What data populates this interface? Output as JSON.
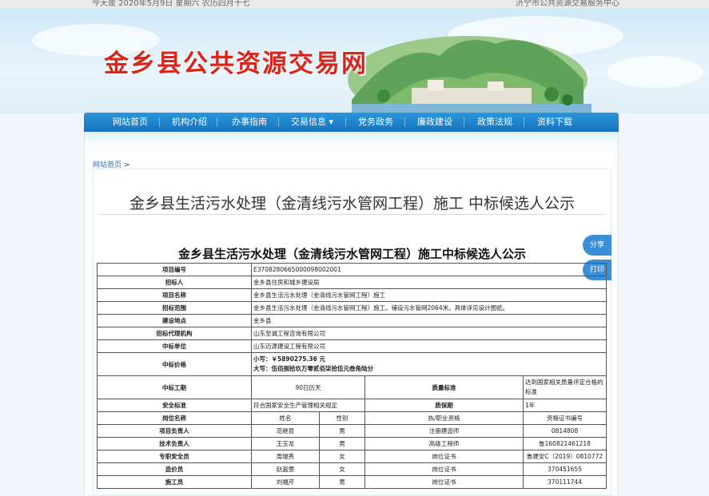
{
  "topbar": {
    "date_text": "今天是 2020年5月9日 星期六 农历四月十七",
    "right_text": "济宁市公共资源交易服务中心"
  },
  "site": {
    "title": "金乡县公共资源交易网"
  },
  "nav": {
    "items": [
      {
        "label": "网站首页"
      },
      {
        "label": "机构介绍"
      },
      {
        "label": "办事指南"
      },
      {
        "label": "交易信息 ▾"
      },
      {
        "label": "党务政务"
      },
      {
        "label": "廉政建设"
      },
      {
        "label": "政策法规"
      },
      {
        "label": "资料下载"
      }
    ]
  },
  "breadcrumb": {
    "home": "网站首页",
    "separator": ">"
  },
  "page_title": "金乡县生活污水处理（金清线污水管网工程）施工 中标候选人公示",
  "doc_title": "金乡县生活污水处理（金清线污水管网工程）施工中标候选人公示",
  "side": {
    "share": "分享",
    "print": "打印"
  },
  "table": {
    "project_no": {
      "label": "项目编号",
      "value": "E3708280665000098002001"
    },
    "tenderer": {
      "label": "招标人",
      "value": "金乡县住房和城乡建设局"
    },
    "project_name": {
      "label": "项目名称",
      "value": "金乡县生活污水处理（金清线污水管网工程）施工"
    },
    "scope": {
      "label": "招标范围",
      "value": "金乡县生活污水处理（金清线污水管网工程）施工。铺设污水管网2064米。具体详见设计图纸。"
    },
    "location": {
      "label": "建设地点",
      "value": "金乡县"
    },
    "agency": {
      "label": "招标代理机构",
      "value": "山东至诚工程咨询有限公司"
    },
    "winner": {
      "label": "中标单位",
      "value": "山东迈源建设工程有限公司"
    },
    "price": {
      "label": "中标价格",
      "small": "小写：￥5890275.36  元",
      "big": "大写：伍佰捌拾玖万零贰佰柒拾伍元叁角陆分"
    },
    "period": {
      "label": "中标工期",
      "value": "90日历天",
      "quality_label": "质量标准",
      "quality_value": "达到国家相关质量评定合格的标准"
    },
    "safety": {
      "label": "安全标准",
      "value": "符合国家安全生产管理相关规定",
      "warranty_label": "质保期",
      "warranty_value": "1年"
    },
    "staff_header": {
      "role": "岗位名称",
      "name": "姓名",
      "gender": "性别",
      "qual": "执/职业资格",
      "cert": "资格证书编号"
    },
    "staff": [
      {
        "role": "项目负责人",
        "name": "范继昆",
        "gender": "男",
        "qual": "注册建造师",
        "cert": "0814808"
      },
      {
        "role": "技术负责人",
        "name": "王玉龙",
        "gender": "男",
        "qual": "高级工程师",
        "cert": "鲁160821461218"
      },
      {
        "role": "专职安全员",
        "name": "周瑞秀",
        "gender": "女",
        "qual": "岗位证书",
        "cert": "鲁建安C（2019）0810772"
      },
      {
        "role": "造价员",
        "name": "赵嘉雯",
        "gender": "女",
        "qual": "岗位证书",
        "cert": "370451655"
      },
      {
        "role": "施工员",
        "name": "刘福芹",
        "gender": "男",
        "qual": "岗位证书",
        "cert": "370111744"
      }
    ]
  }
}
